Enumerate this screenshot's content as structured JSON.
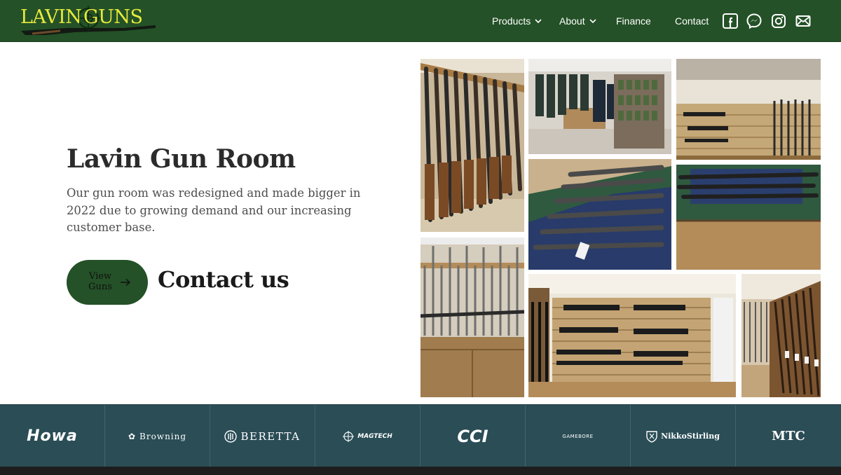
{
  "header": {
    "logo": {
      "word_left": "LAVIN",
      "word_right": "GUNS",
      "color": "#e7ea3c"
    },
    "nav": [
      {
        "label": "Products",
        "has_dropdown": true
      },
      {
        "label": "About",
        "has_dropdown": true
      },
      {
        "label": "Finance",
        "has_dropdown": false
      },
      {
        "label": "Contact",
        "has_dropdown": false
      }
    ],
    "social_icons": [
      "facebook-icon",
      "messenger-icon",
      "instagram-icon",
      "mail-icon"
    ],
    "background": "#245127"
  },
  "hero": {
    "title": "Lavin Gun Room",
    "description": "Our gun room was redesigned and made bigger in 2022 due to growing demand and our increasing customer base.",
    "cta": {
      "label": "View Guns",
      "background": "#245127"
    },
    "contact_link": "Contact us"
  },
  "gallery": {
    "photos": [
      "gun-rack-shotguns",
      "shop-clothing-wall",
      "wall-mounted-rifles",
      "display-table-rifles",
      "display-table-rifles-right",
      "shotgun-rack-lower",
      "slatwall-rifles",
      "long-shotgun-rack"
    ]
  },
  "brands": {
    "background": "#2a4d56",
    "items": [
      {
        "label": "Howa"
      },
      {
        "label": "Browning"
      },
      {
        "label": "BERETTA"
      },
      {
        "label": "MAGTECH"
      },
      {
        "label": "CCI"
      },
      {
        "label": "GAMEBORE"
      },
      {
        "label": "NikkoStirling"
      },
      {
        "label": "MTC"
      }
    ]
  }
}
